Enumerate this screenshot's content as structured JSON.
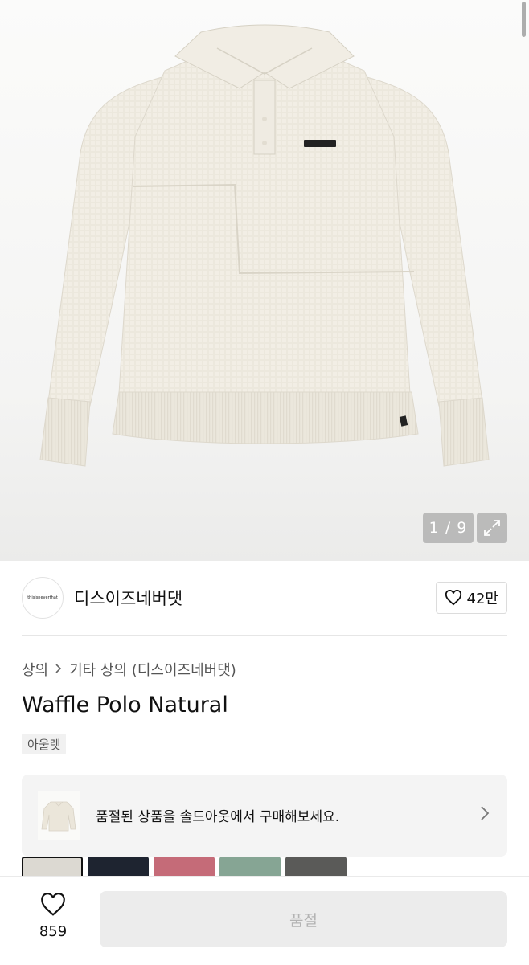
{
  "gallery": {
    "current_index": "1 / 9",
    "expand_icon": "expand-icon"
  },
  "brand": {
    "logo_text": "thisisneverthat",
    "name": "디스이즈네버댓",
    "like_count": "42만",
    "like_icon": "heart-outline-icon"
  },
  "breadcrumb": {
    "level1": "상의",
    "separator": ">",
    "level2": "기타 상의 (디스이즈네버댓)"
  },
  "product": {
    "title": "Waffle Polo Natural",
    "tag": "아울렛"
  },
  "soldout_banner": {
    "text": "품절된 상품을 솔드아웃에서 구매해보세요.",
    "chevron_icon": "chevron-right-icon"
  },
  "color_swatches": [
    "#dcd9d2",
    "#1e2430",
    "#c56b78",
    "#86a594",
    "#5a5a58"
  ],
  "bottom_bar": {
    "wish_count": "859",
    "buy_label": "품절"
  }
}
